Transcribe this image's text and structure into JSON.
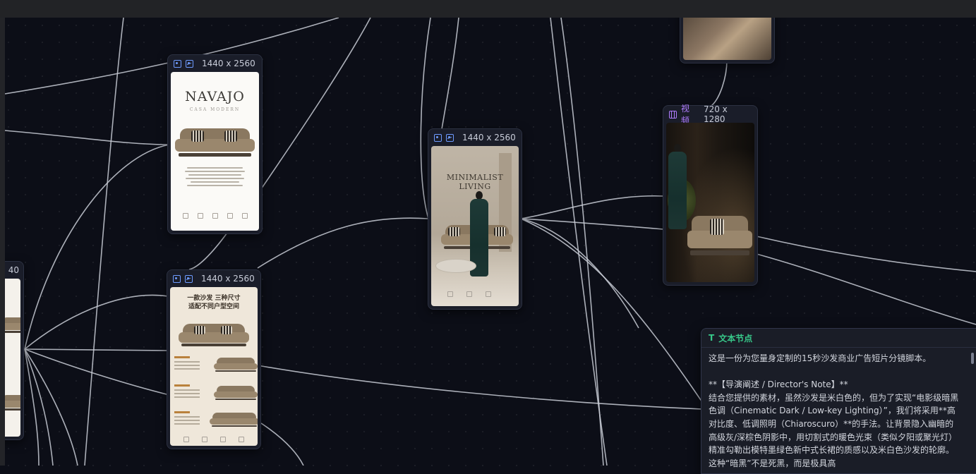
{
  "canvas": {
    "nodes": [
      {
        "id": "navajo",
        "size_label": "1440 x 2560",
        "poster_title": "NAVAJO",
        "poster_subtitle": "CASA MODERN"
      },
      {
        "id": "living",
        "size_label": "1440 x 2560",
        "poster_title": "MINIMALIST LIVING"
      },
      {
        "id": "promo",
        "size_label": "1440 x 2560",
        "poster_title": "一款沙发  三种尺寸\n适配不同户型空间"
      },
      {
        "id": "video",
        "type_label": "视频",
        "size_label": "720 x 1280"
      },
      {
        "id": "leftcut",
        "size_label": "40"
      }
    ],
    "text_node": {
      "title": "文本节点",
      "icon": "T",
      "body": "这是一份为您量身定制的15秒沙发商业广告短片分镜脚本。\n\n**【导演阐述 / Director's Note】**\n结合您提供的素材，虽然沙发是米白色的，但为了实现“电影级暗黑色调（Cinematic Dark / Low-key Lighting）”，我们将采用**高对比度、低调照明（Chiaroscuro）**的手法。让背景隐入幽暗的高级灰/深棕色阴影中，用切割式的暖色光束（类似夕阳或聚光灯）精准勾勒出模特墨绿色新中式长裙的质感以及米白色沙发的轮廓。这种“暗黑”不是死黑，而是极具高"
    }
  },
  "colors": {
    "canvas_bg": "#0c0e17",
    "edge": "#c9cdd6",
    "text_node_accent": "#37c98a",
    "video_accent": "#b07cff",
    "image_accent": "#6e9bff"
  }
}
